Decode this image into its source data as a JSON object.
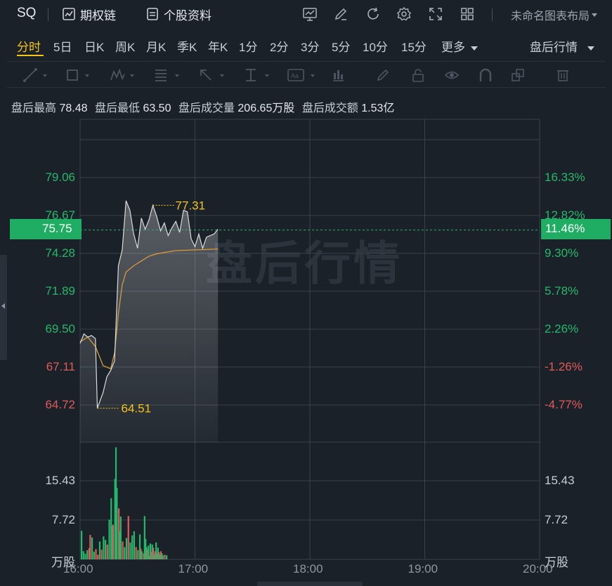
{
  "header": {
    "ticker": "SQ",
    "options_chain_label": "期权链",
    "stock_info_label": "个股资料",
    "layout_label": "未命名图表布局"
  },
  "tabs": [
    "分时",
    "5日",
    "日K",
    "周K",
    "月K",
    "季K",
    "年K",
    "1分",
    "2分",
    "3分",
    "5分",
    "10分",
    "15分",
    "更多"
  ],
  "active_tab": "分时",
  "session_label": "盘后行情",
  "drawing_tools": [
    "trendline-icon",
    "rectangle-icon",
    "wave-icon",
    "fib-icon",
    "arrow-icon",
    "measure-icon",
    "text-icon",
    "pattern-icon",
    "pen-icon",
    "lock-icon",
    "eye-icon",
    "magnet-icon",
    "layers-icon",
    "trash-icon"
  ],
  "stats": {
    "high_label": "盘后最高",
    "high_value": "78.48",
    "low_label": "盘后最低",
    "low_value": "63.50",
    "volume_label": "盘后成交量",
    "volume_value": "206.65万股",
    "turnover_label": "盘后成交额",
    "turnover_value": "1.53亿"
  },
  "watermark": "盘后行情",
  "colors": {
    "up": "#26b86a",
    "down": "#e05a5a",
    "accent": "#f5c518",
    "avg_line": "#d89a3a",
    "price_line": "#dcdcdc"
  },
  "chart_data": {
    "type": "line",
    "y_ticks_left": [
      "79.06",
      "76.67",
      "74.28",
      "71.89",
      "69.50",
      "67.11",
      "64.72"
    ],
    "y_ticks_right": [
      "16.33%",
      "12.82%",
      "9.30%",
      "5.78%",
      "2.26%",
      "-1.26%",
      "-4.77%"
    ],
    "x_ticks": [
      "16:00",
      "17:00",
      "18:00",
      "19:00",
      "20:00"
    ],
    "ylim": [
      64.72,
      79.06
    ],
    "current_price": "75.75",
    "current_pct": "11.46%",
    "high_marker": "77.31",
    "low_marker": "64.51",
    "volume_ticks": [
      "15.43",
      "7.72"
    ],
    "volume_unit": "万股",
    "price": [
      [
        0,
        68.6
      ],
      [
        2,
        69.2
      ],
      [
        4,
        69.0
      ],
      [
        6,
        69.1
      ],
      [
        8,
        68.9
      ],
      [
        9,
        64.51
      ],
      [
        12,
        65.5
      ],
      [
        14,
        66.5
      ],
      [
        16,
        66.9
      ],
      [
        18,
        67.5
      ],
      [
        20,
        73.5
      ],
      [
        22,
        74.5
      ],
      [
        24,
        77.6
      ],
      [
        26,
        77.0
      ],
      [
        28,
        75.5
      ],
      [
        30,
        74.6
      ],
      [
        32,
        76.5
      ],
      [
        34,
        75.8
      ],
      [
        36,
        76.4
      ],
      [
        38,
        77.31
      ],
      [
        40,
        76.6
      ],
      [
        42,
        75.7
      ],
      [
        44,
        76.2
      ],
      [
        46,
        75.4
      ],
      [
        48,
        75.9
      ],
      [
        50,
        76.3
      ],
      [
        52,
        75.6
      ],
      [
        54,
        77.0
      ],
      [
        56,
        76.9
      ],
      [
        58,
        75.2
      ],
      [
        60,
        74.7
      ],
      [
        62,
        75.5
      ],
      [
        64,
        74.6
      ],
      [
        66,
        75.3
      ],
      [
        68,
        75.4
      ],
      [
        70,
        75.5
      ],
      [
        72,
        75.8
      ]
    ],
    "average": [
      [
        0,
        68.7
      ],
      [
        4,
        69.0
      ],
      [
        8,
        68.4
      ],
      [
        12,
        67.2
      ],
      [
        16,
        67.0
      ],
      [
        18,
        68.0
      ],
      [
        20,
        70.5
      ],
      [
        22,
        72.3
      ],
      [
        24,
        73.1
      ],
      [
        28,
        73.5
      ],
      [
        32,
        73.8
      ],
      [
        36,
        74.1
      ],
      [
        40,
        74.25
      ],
      [
        50,
        74.45
      ],
      [
        60,
        74.5
      ],
      [
        72,
        74.55
      ]
    ],
    "volume": [
      [
        0,
        5.6,
        "up"
      ],
      [
        2,
        1.6,
        "up"
      ],
      [
        4,
        1.1,
        "up"
      ],
      [
        6,
        1.8,
        "up"
      ],
      [
        8,
        2.2,
        "down"
      ],
      [
        9,
        4.8,
        "down"
      ],
      [
        11,
        4.3,
        "up"
      ],
      [
        13,
        1.5,
        "up"
      ],
      [
        15,
        2.0,
        "down"
      ],
      [
        17,
        0.9,
        "down"
      ],
      [
        19,
        3.5,
        "up"
      ],
      [
        21,
        1.9,
        "down"
      ],
      [
        23,
        4.5,
        "up"
      ],
      [
        25,
        3.8,
        "up"
      ],
      [
        27,
        2.9,
        "down"
      ],
      [
        29,
        7.8,
        "up"
      ],
      [
        31,
        12.0,
        "up"
      ],
      [
        32,
        6.5,
        "up"
      ],
      [
        33,
        6.8,
        "down"
      ],
      [
        35,
        15.8,
        "up"
      ],
      [
        36,
        22.0,
        "up"
      ],
      [
        37,
        14.0,
        "up"
      ],
      [
        39,
        10.0,
        "down"
      ],
      [
        40,
        5.5,
        "up"
      ],
      [
        41,
        8.4,
        "up"
      ],
      [
        43,
        3.5,
        "down"
      ],
      [
        45,
        2.4,
        "up"
      ],
      [
        47,
        4.2,
        "up"
      ],
      [
        49,
        8.5,
        "down"
      ],
      [
        51,
        3.3,
        "up"
      ],
      [
        53,
        4.7,
        "up"
      ],
      [
        55,
        5.5,
        "up"
      ],
      [
        57,
        2.4,
        "down"
      ],
      [
        59,
        1.8,
        "up"
      ],
      [
        61,
        4.9,
        "up"
      ],
      [
        62,
        2.1,
        "down"
      ],
      [
        63,
        1.6,
        "up"
      ],
      [
        65,
        1.2,
        "down"
      ],
      [
        66,
        8.5,
        "up"
      ],
      [
        67,
        4.0,
        "up"
      ],
      [
        68,
        2.4,
        "up"
      ],
      [
        69,
        1.9,
        "down"
      ],
      [
        70,
        2.7,
        "up"
      ],
      [
        71,
        0.7,
        "up"
      ],
      [
        72,
        3.1,
        "up"
      ],
      [
        73,
        1.4,
        "down"
      ],
      [
        74,
        2.9,
        "up"
      ],
      [
        75,
        2.3,
        "down"
      ],
      [
        76,
        1.0,
        "up"
      ],
      [
        77,
        1.6,
        "down"
      ],
      [
        78,
        3.3,
        "up"
      ],
      [
        79,
        1.2,
        "up"
      ],
      [
        80,
        2.3,
        "up"
      ],
      [
        81,
        1.4,
        "down"
      ],
      [
        82,
        0.9,
        "up"
      ],
      [
        83,
        1.6,
        "down"
      ],
      [
        84,
        1.2,
        "up"
      ],
      [
        85,
        0.8,
        "up"
      ],
      [
        87,
        0.9,
        "down"
      ],
      [
        89,
        0.8,
        "up"
      ]
    ]
  }
}
